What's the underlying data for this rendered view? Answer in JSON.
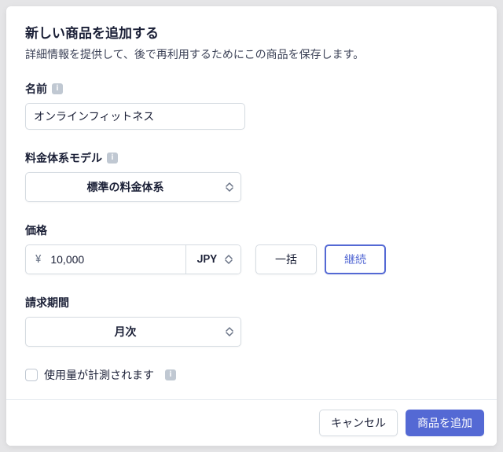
{
  "header": {
    "title": "新しい商品を追加する",
    "subtitle": "詳細情報を提供して、後で再利用するためにこの商品を保存します。"
  },
  "fields": {
    "name": {
      "label": "名前",
      "value": "オンラインフィットネス"
    },
    "pricing_model": {
      "label": "料金体系モデル",
      "selected": "標準の料金体系"
    },
    "price": {
      "label": "価格",
      "symbol": "¥",
      "amount": "10,000",
      "currency": "JPY",
      "one_time": "一括",
      "recurring": "継続"
    },
    "billing_period": {
      "label": "請求期間",
      "selected": "月次"
    },
    "usage_metered": {
      "label": "使用量が計測されます"
    }
  },
  "footer": {
    "cancel": "キャンセル",
    "submit": "商品を追加"
  }
}
